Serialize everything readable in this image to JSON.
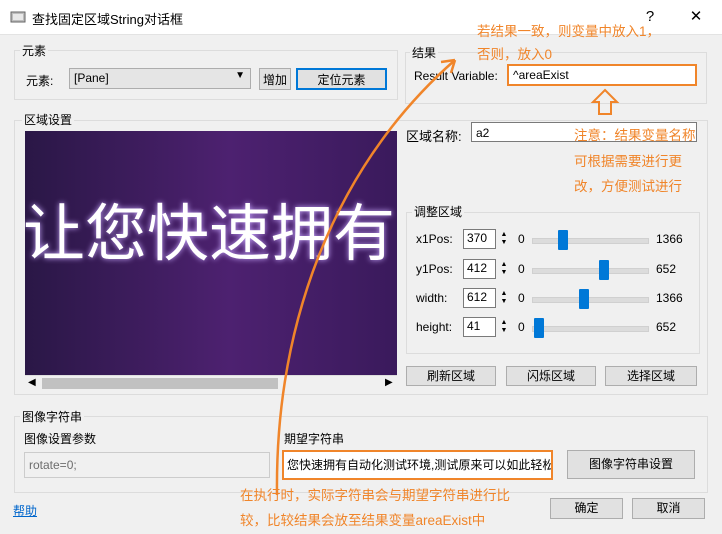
{
  "window": {
    "title": "查找固定区域String对话框",
    "help_btn": "?",
    "close_btn": "✕"
  },
  "element_group": {
    "label": "元素",
    "field_label": "元素:",
    "combo_value": "[Pane]",
    "add_btn": "增加",
    "locate_btn": "定位元素"
  },
  "result_group": {
    "label": "结果",
    "var_label": "Result Variable:",
    "var_value": "^areaExist"
  },
  "region_group": {
    "label": "区域设置"
  },
  "preview_text": "让您快速拥有自动化测试环境，测",
  "region_name": {
    "label": "区域名称:",
    "value": "a2"
  },
  "adjust_group": {
    "label": "调整区域",
    "rows": [
      {
        "label": "x1Pos:",
        "value": "370",
        "min": "0",
        "max": "1366",
        "level": 0.27
      },
      {
        "label": "y1Pos:",
        "value": "412",
        "min": "0",
        "max": "652",
        "level": 0.63
      },
      {
        "label": "width:",
        "value": "612",
        "min": "0",
        "max": "1366",
        "level": 0.45
      },
      {
        "label": "height:",
        "value": "41",
        "min": "0",
        "max": "652",
        "level": 0.06
      }
    ]
  },
  "buttons": {
    "refresh": "刷新区域",
    "flash": "闪烁区域",
    "select": "选择区域",
    "image_string_settings": "图像字符串设置",
    "ok": "确定",
    "cancel": "取消"
  },
  "image_string_group": {
    "label": "图像字符串",
    "params_label": "图像设置参数",
    "params_value": "rotate=0;",
    "expected_label": "期望字符串",
    "expected_value": "您快速拥有自动化测试环境,测试原来可以如此轻松"
  },
  "help_link": "帮助",
  "annotations": {
    "top_line1": "若结果一致，则变量中放入1，",
    "top_line2": "否则，放入0",
    "note_line1": "注意：结果变量名称",
    "note_line2": "可根据需要进行更",
    "note_line3": "改，方便测试进行",
    "bottom_line1": "在执行时，实际字符串会与期望字符串进行比",
    "bottom_line2": "较，比较结果会放至结果变量areaExist中"
  },
  "colors": {
    "accent": "#0078d7",
    "annotation": "#f0852a",
    "preview_bg_start": "#2a1746",
    "preview_bg_end": "#4d2170"
  }
}
